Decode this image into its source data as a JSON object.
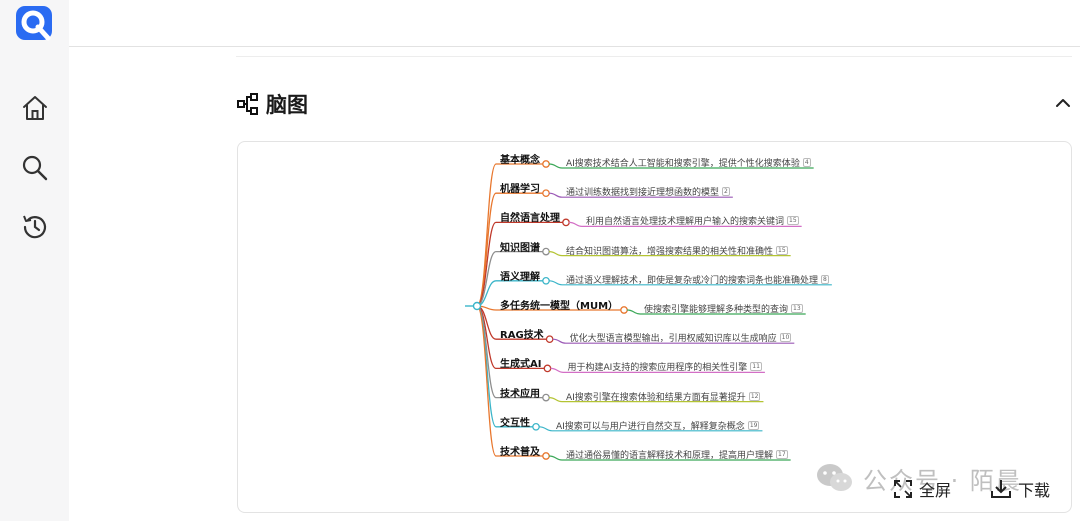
{
  "section": {
    "title": "脑图"
  },
  "mindmap": {
    "nodes": [
      {
        "label": "基本概念",
        "desc": "AI搜索技术结合人工智能和搜索引擎，提供个性化搜索体验",
        "ref": "4",
        "color": "#e8772e",
        "leaf_color": "#3aa757"
      },
      {
        "label": "机器学习",
        "desc": "通过训练数据找到接近理想函数的模型",
        "ref": "2",
        "color": "#e8772e",
        "leaf_color": "#9b59b6"
      },
      {
        "label": "自然语言处理",
        "desc": "利用自然语言处理技术理解用户输入的搜索关键词",
        "ref": "15",
        "color": "#c0392b",
        "leaf_color": "#d36fc6"
      },
      {
        "label": "知识图谱",
        "desc": "结合知识图谱算法，增强搜索结果的相关性和准确性",
        "ref": "15",
        "color": "#8e8e8e",
        "leaf_color": "#b4c433"
      },
      {
        "label": "语义理解",
        "desc": "通过语义理解技术，即使是复杂或冷门的搜索词条也能准确处理",
        "ref": "8",
        "color": "#3bb5c9",
        "leaf_color": "#3bb5c9"
      },
      {
        "label": "多任务统一模型（MUM）",
        "desc": "使搜索引擎能够理解多种类型的查询",
        "ref": "13",
        "color": "#e8772e",
        "leaf_color": "#3aa757"
      },
      {
        "label": "RAG技术",
        "desc": "优化大型语言模型输出，引用权威知识库以生成响应",
        "ref": "10",
        "color": "#c0392b",
        "leaf_color": "#9b59b6"
      },
      {
        "label": "生成式AI",
        "desc": "用于构建AI支持的搜索应用程序的相关性引擎",
        "ref": "11",
        "color": "#c0392b",
        "leaf_color": "#d36fc6"
      },
      {
        "label": "技术应用",
        "desc": "AI搜索引擎在搜索体验和结果方面有显著提升",
        "ref": "12",
        "color": "#8e8e8e",
        "leaf_color": "#b4c433"
      },
      {
        "label": "交互性",
        "desc": "AI搜索可以与用户进行自然交互，解释复杂概念",
        "ref": "19",
        "color": "#3bb5c9",
        "leaf_color": "#3bb5c9"
      },
      {
        "label": "技术普及",
        "desc": "通过通俗易懂的语言解释技术和原理，提高用户理解",
        "ref": "17",
        "color": "#e8772e",
        "leaf_color": "#3aa757"
      }
    ]
  },
  "toolbar": {
    "fullscreen_label": "全屏",
    "download_label": "下载"
  },
  "watermark": {
    "text": "公众号 · 陌晨"
  }
}
